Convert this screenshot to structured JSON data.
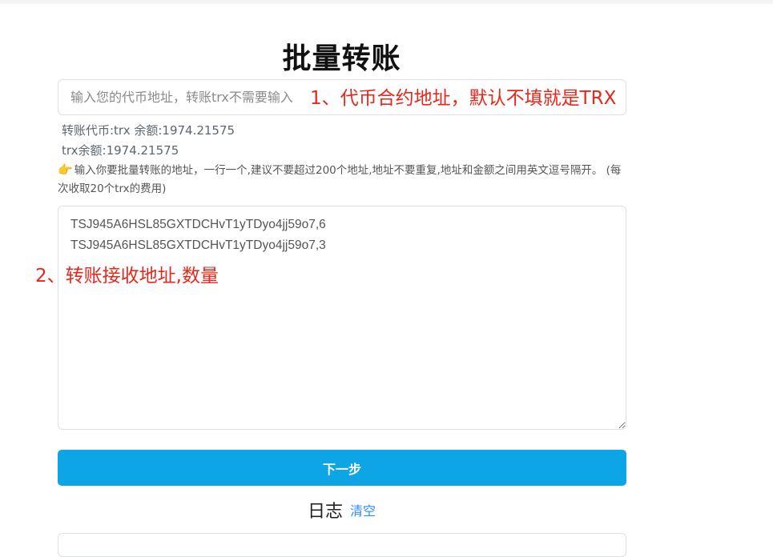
{
  "page": {
    "title": "批量转账"
  },
  "token_input": {
    "placeholder": "输入您的代币地址，转账trx不需要输入",
    "value": ""
  },
  "annotations": {
    "note_1": "1、代币合约地址，默认不填就是TRX",
    "note_2": "2、转账接收地址,数量"
  },
  "balance": {
    "token_line": "转账代币:trx 余额:1974.21575",
    "trx_line": "trx余额:1974.21575"
  },
  "hint": {
    "icon": "pointing-hand-icon",
    "text": "输入你要批量转账的地址，一行一个,建议不要超过200个地址,地址不要重复,地址和金额之间用英文逗号隔开。 (每次收取20个trx的费用)"
  },
  "address_textarea": {
    "value": "TSJ945A6HSL85GXTDCHvT1yTDyo4jj59o7,6\nTSJ945A6HSL85GXTDCHvT1yTDyo4jj59o7,3"
  },
  "next_button": {
    "label": "下一步",
    "color": "#0ea5e6"
  },
  "log": {
    "title": "日志",
    "clear_label": "清空"
  },
  "colors": {
    "annotation": "#e8261a",
    "link": "#2d8cf0"
  }
}
